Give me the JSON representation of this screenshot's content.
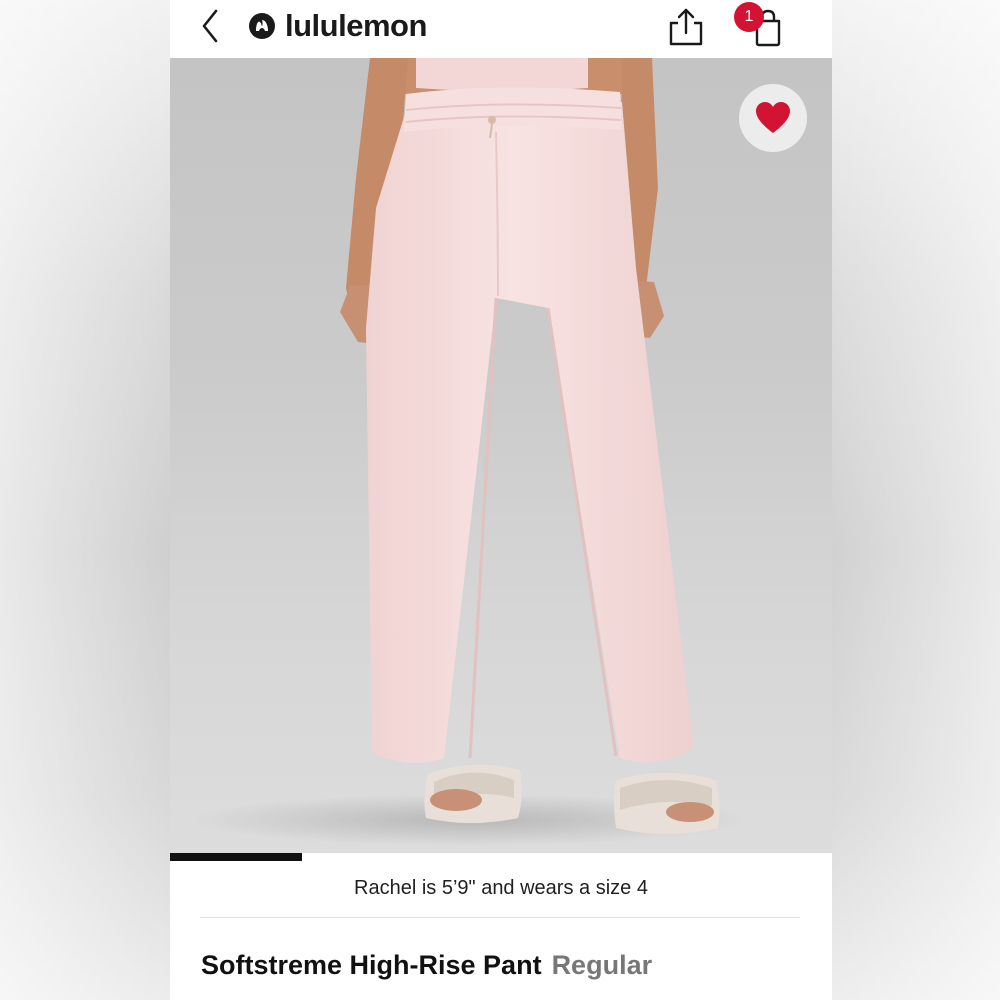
{
  "header": {
    "brand": "lululemon",
    "bag_count": "1"
  },
  "gallery": {
    "progress": 0.2
  },
  "product": {
    "model_info": "Rachel is 5’9\" and wears a size 4",
    "name": "Softstreme High-Rise Pant",
    "fit": "Regular"
  },
  "colors": {
    "accent": "#d31334",
    "text": "#111111",
    "muted": "#777777",
    "product_color": "#f6dfde"
  }
}
